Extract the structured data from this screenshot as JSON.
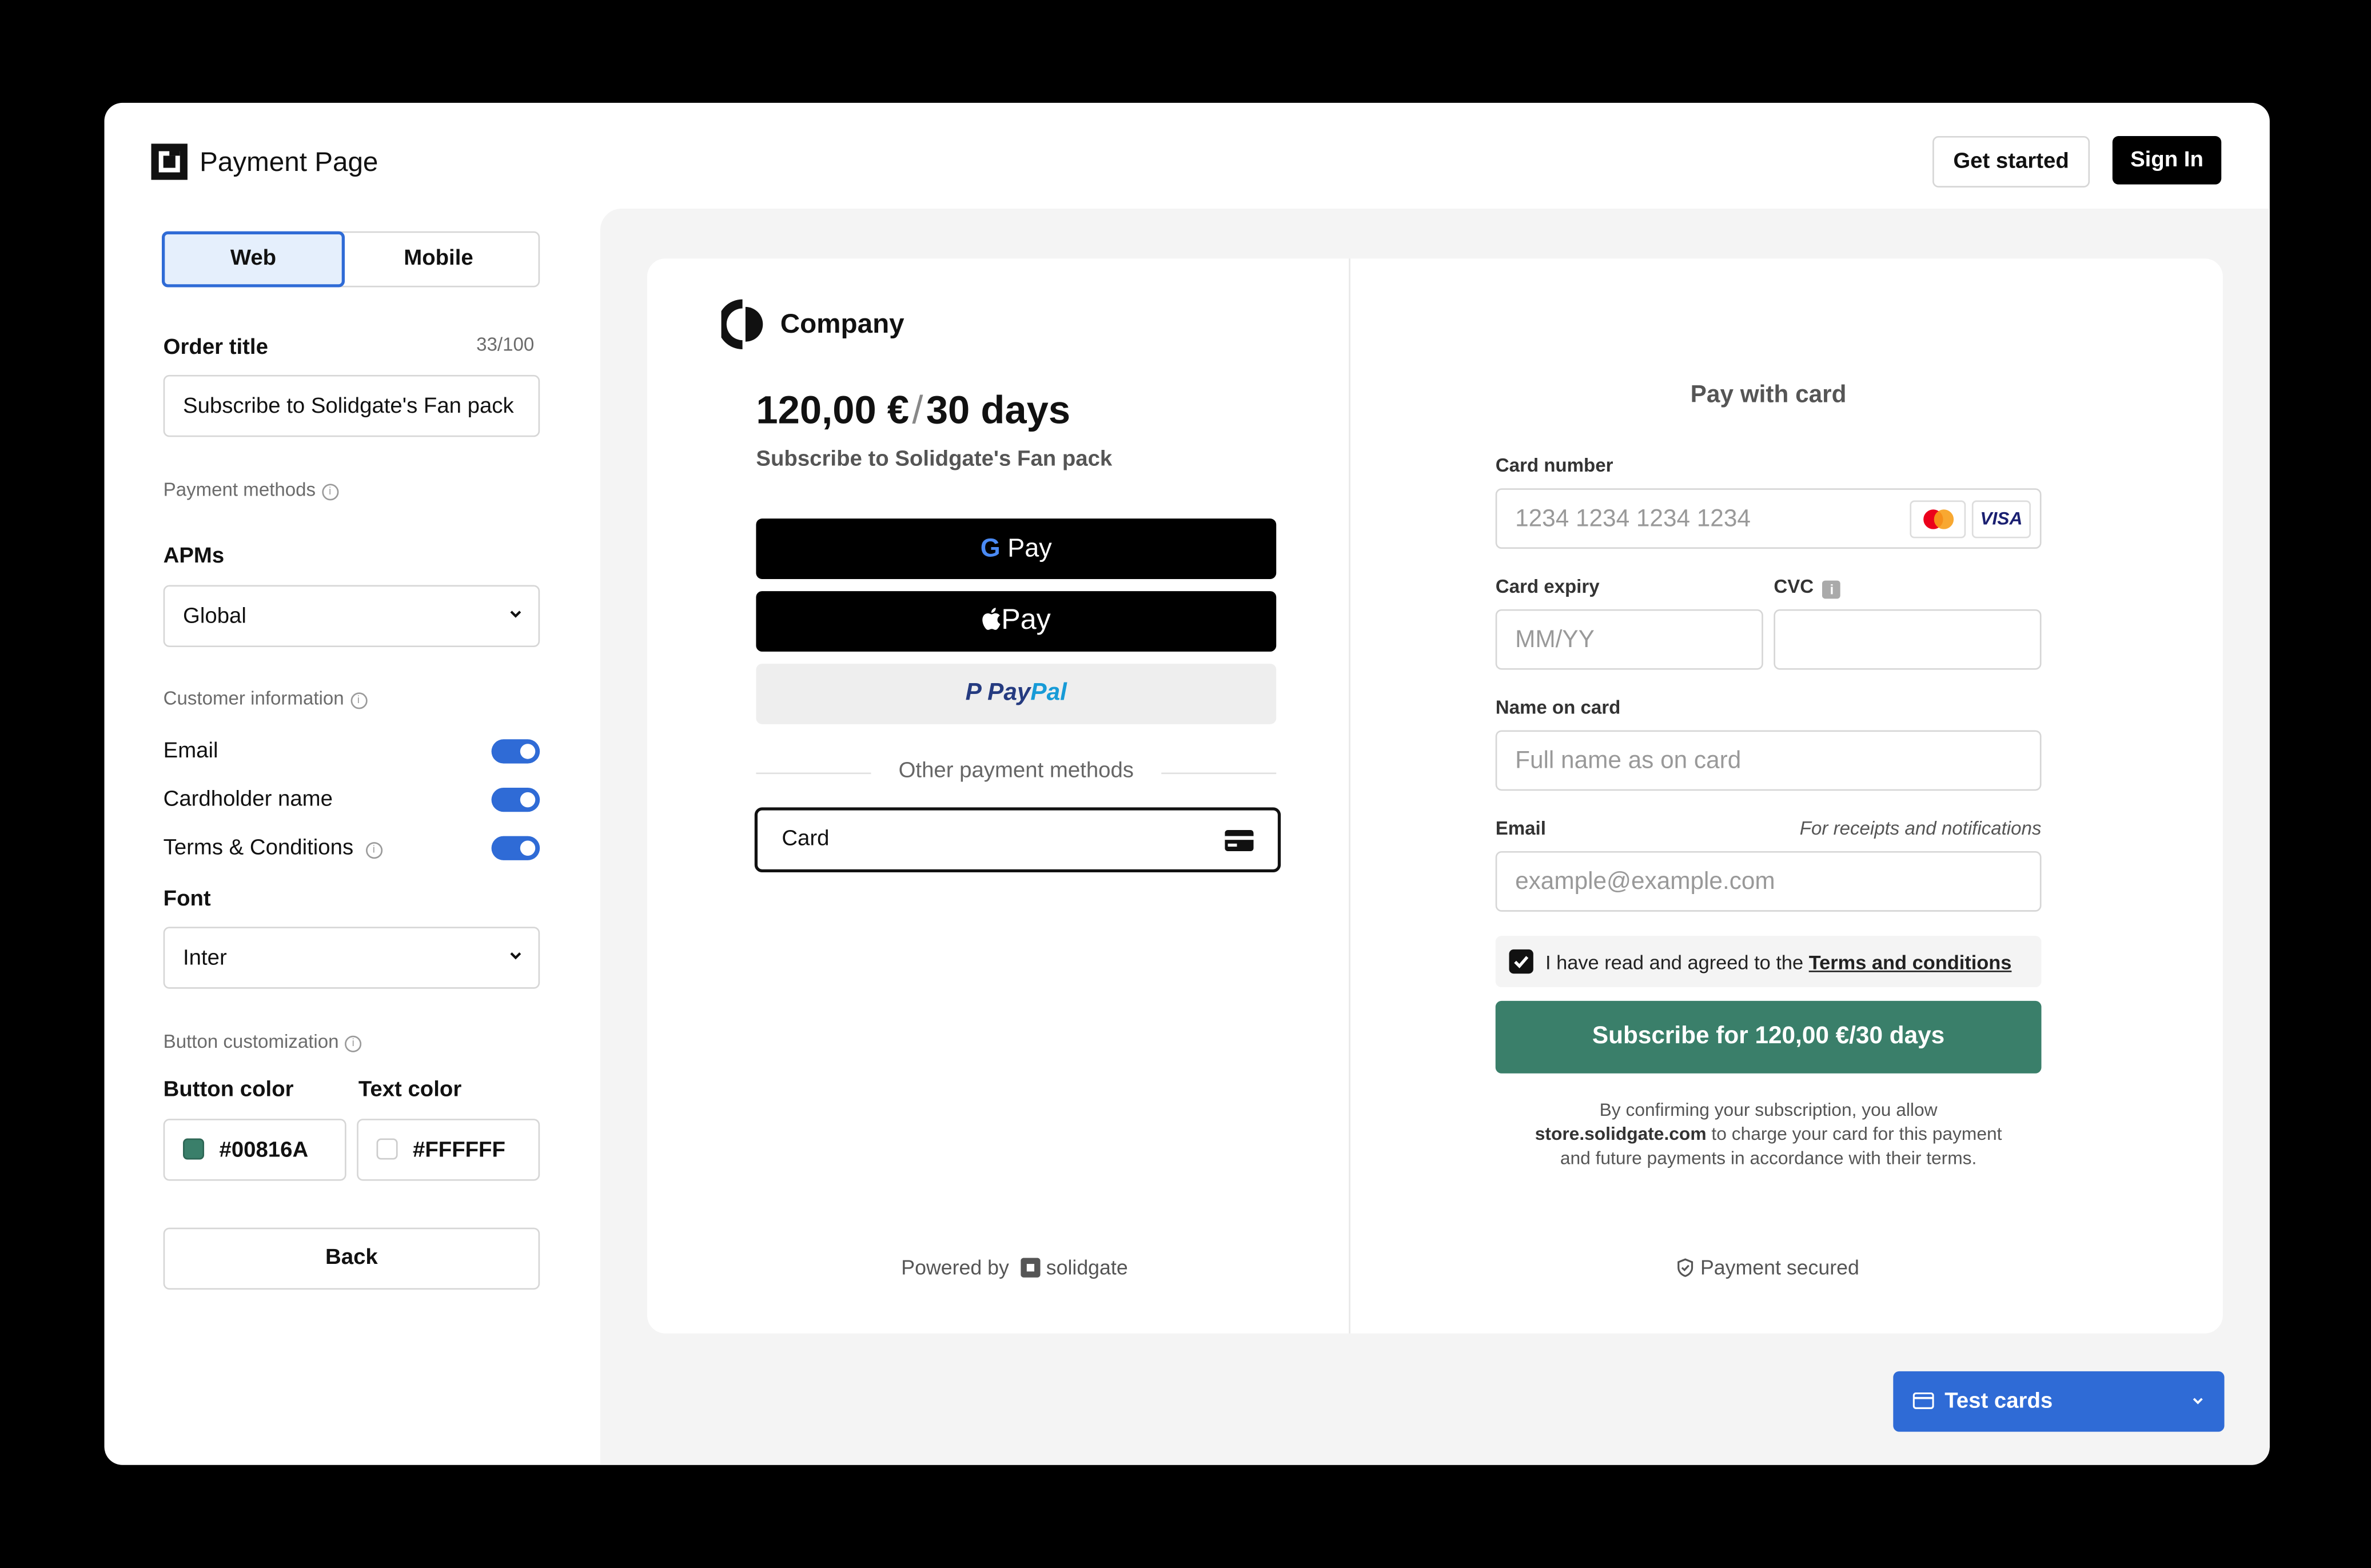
{
  "header": {
    "app_title": "Payment Page",
    "get_started_label": "Get started",
    "sign_in_label": "Sign In"
  },
  "config": {
    "tabs": [
      {
        "label": "Web",
        "active": true
      },
      {
        "label": "Mobile",
        "active": false
      }
    ],
    "order_title_label": "Order title",
    "order_title_count": "33/100",
    "order_title_value": "Subscribe to Solidgate's Fan pack",
    "payment_methods_heading": "Payment methods",
    "apms_label": "APMs",
    "apms_value": "Global",
    "customer_info_heading": "Customer information",
    "toggles": [
      {
        "label": "Email",
        "on": true
      },
      {
        "label": "Cardholder name",
        "on": true
      },
      {
        "label": "Terms & Conditions",
        "on": true
      }
    ],
    "font_label": "Font",
    "font_value": "Inter",
    "button_customization_heading": "Button customization",
    "button_color_label": "Button color",
    "button_color_value": "#00816A",
    "text_color_label": "Text color",
    "text_color_value": "#FFFFFF",
    "back_label": "Back"
  },
  "preview": {
    "company_name": "Company",
    "price": "120,00 €",
    "period": "30 days",
    "product": "Subscribe to Solidgate's Fan pack",
    "gpay_label": "Pay",
    "applepay_label": "Pay",
    "paypal_label_1": "Pay",
    "paypal_label_2": "Pal",
    "other_methods": "Other payment methods",
    "card_option": "Card",
    "powered_by": "Powered by",
    "powered_brand": "solidgate",
    "pay_with_card": "Pay with card",
    "card_number_label": "Card number",
    "card_number_placeholder": "1234 1234 1234 1234",
    "visa_label": "VISA",
    "card_expiry_label": "Card expiry",
    "card_expiry_placeholder": "MM/YY",
    "cvc_label": "CVC",
    "name_label": "Name on card",
    "name_placeholder": "Full name as on card",
    "email_label": "Email",
    "email_hint": "For receipts and notifications",
    "email_placeholder": "example@example.com",
    "terms_text": "I have read and agreed to the",
    "terms_link": "Terms and conditions",
    "subscribe_button": "Subscribe for 120,00 €/30 days",
    "disclaimer_1": "By confirming your subscription, you allow",
    "disclaimer_store": "store.solidgate.com",
    "disclaimer_2": "to charge your card for this payment",
    "disclaimer_3": "and future payments in accordance with their terms.",
    "secured": "Payment secured"
  },
  "test_cards_label": "Test cards",
  "colors": {
    "accent": "#2f6bd6",
    "button": "#3a7f6a",
    "black": "#000000"
  }
}
